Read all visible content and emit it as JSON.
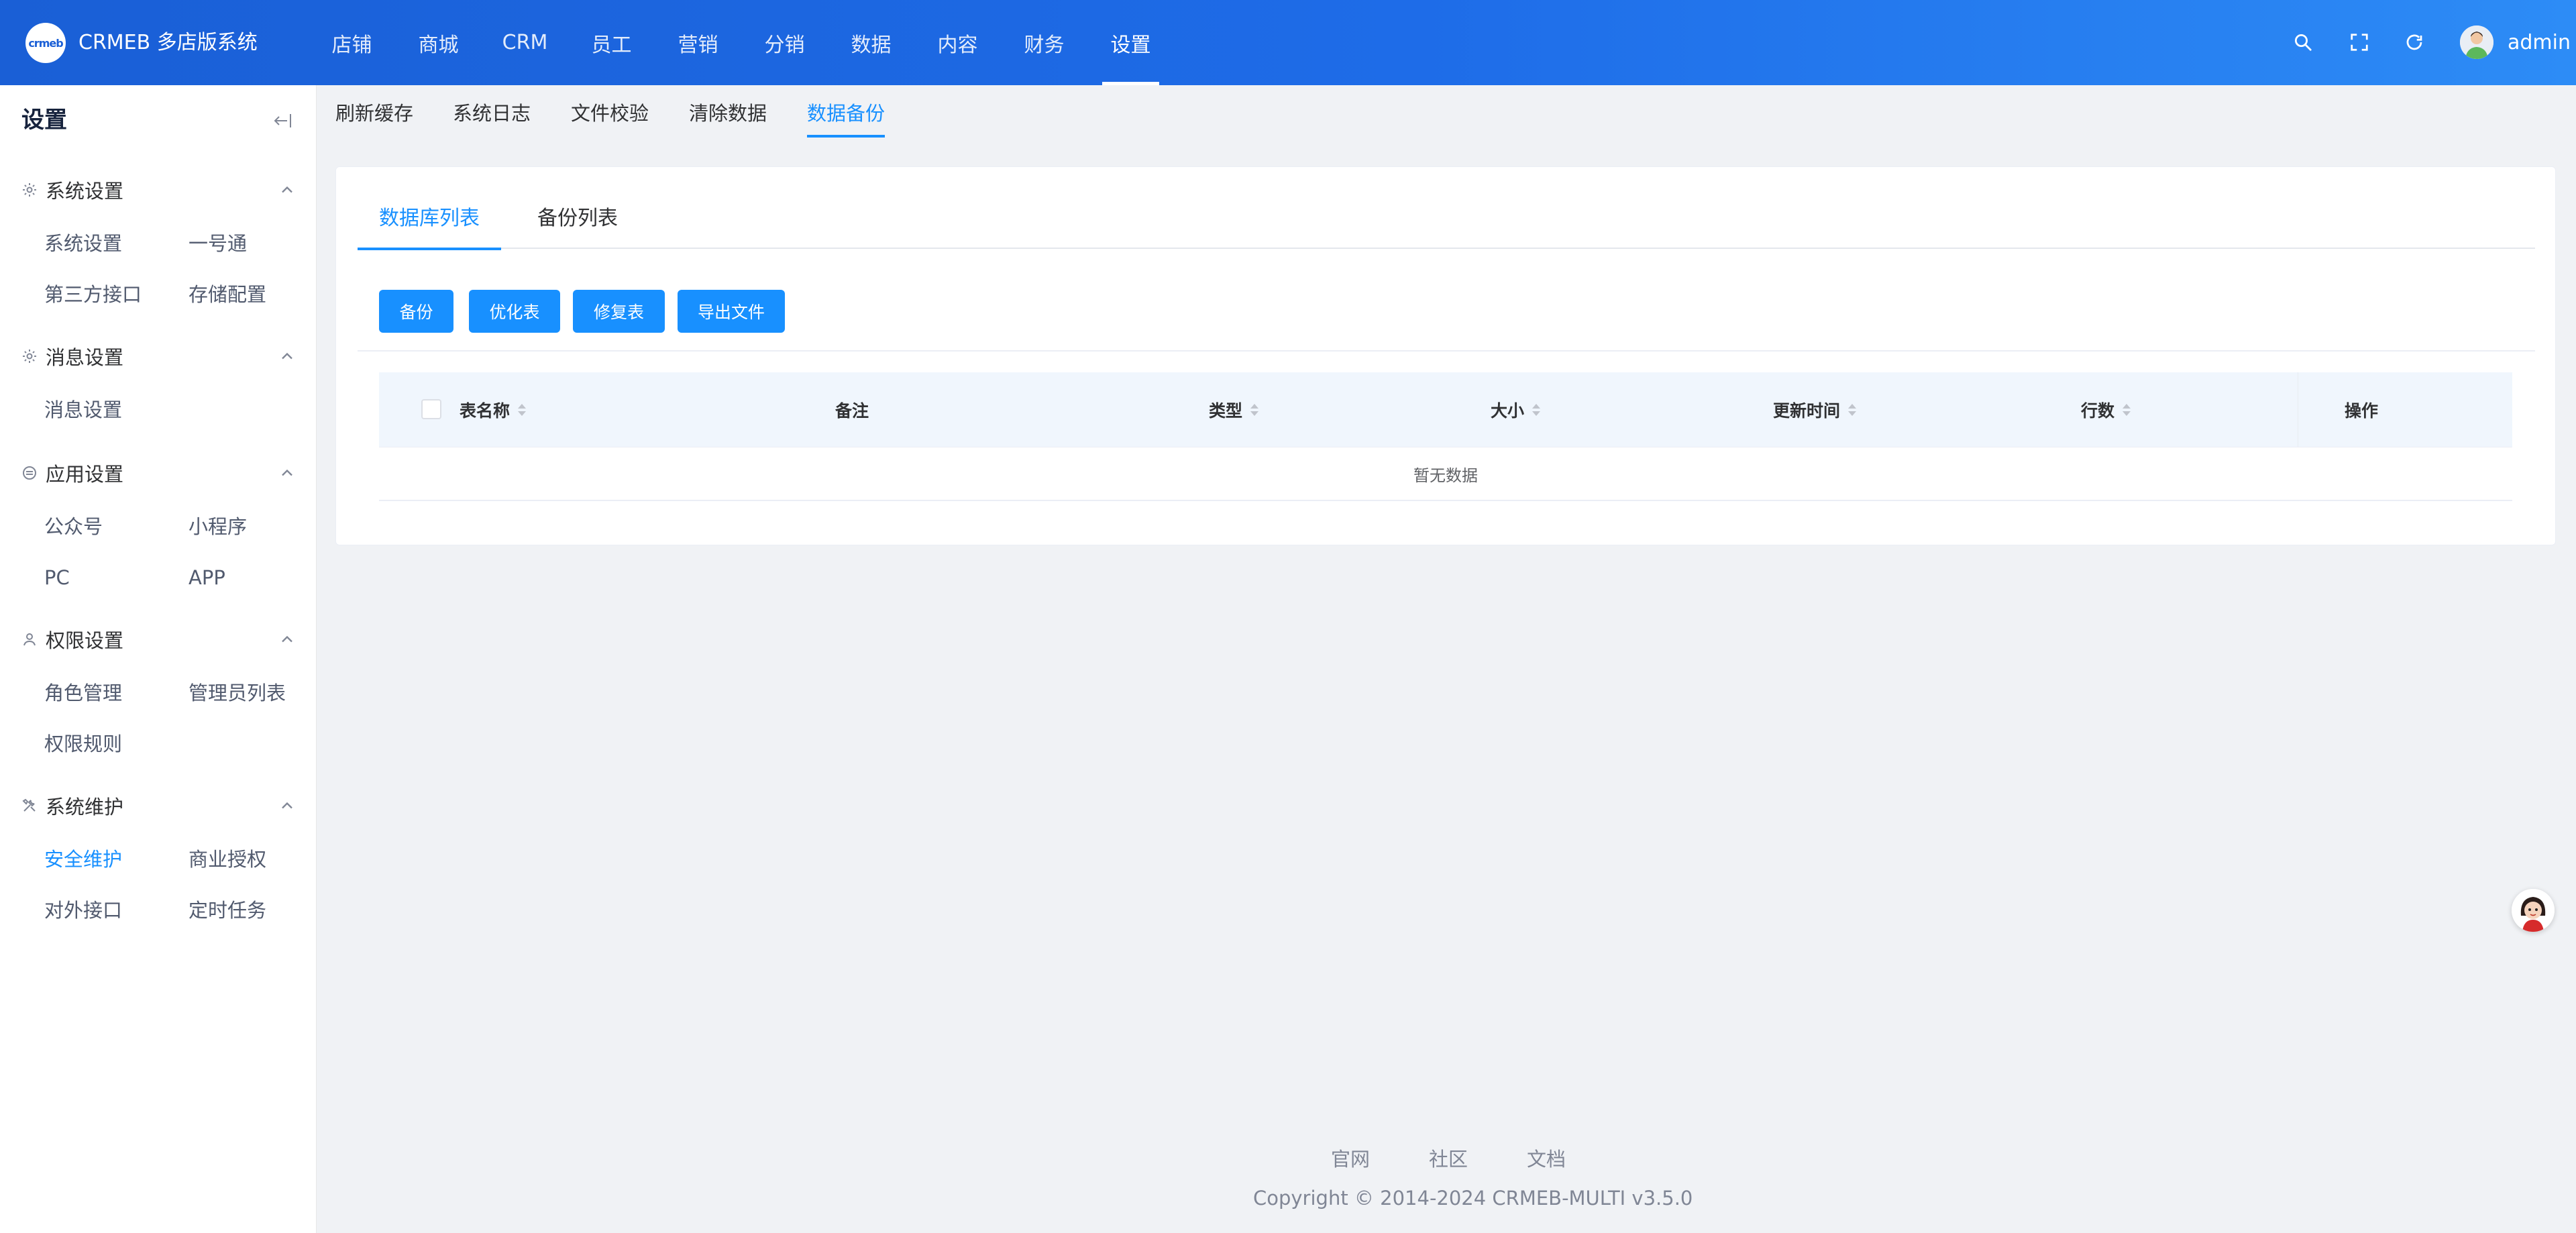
{
  "app": {
    "logo_text": "crmeb",
    "title": "CRMEB 多店版系统"
  },
  "header": {
    "nav": [
      {
        "label": "店铺",
        "active": false
      },
      {
        "label": "商城",
        "active": false
      },
      {
        "label": "CRM",
        "active": false
      },
      {
        "label": "员工",
        "active": false
      },
      {
        "label": "营销",
        "active": false
      },
      {
        "label": "分销",
        "active": false
      },
      {
        "label": "数据",
        "active": false
      },
      {
        "label": "内容",
        "active": false
      },
      {
        "label": "财务",
        "active": false
      },
      {
        "label": "设置",
        "active": true
      }
    ],
    "icons": [
      "search-icon",
      "fullscreen-icon",
      "refresh-icon"
    ],
    "user": "admin"
  },
  "sidebar": {
    "title": "设置",
    "groups": [
      {
        "label": "系统设置",
        "icon": "gear-icon",
        "items": [
          "系统设置",
          "一号通",
          "第三方接口",
          "存储配置"
        ]
      },
      {
        "label": "消息设置",
        "icon": "gear-icon",
        "items": [
          "消息设置"
        ]
      },
      {
        "label": "应用设置",
        "icon": "circle-icon",
        "items": [
          "公众号",
          "小程序",
          "PC",
          "APP"
        ]
      },
      {
        "label": "权限设置",
        "icon": "user-icon",
        "items": [
          "角色管理",
          "管理员列表",
          "权限规则"
        ]
      },
      {
        "label": "系统维护",
        "icon": "tools-icon",
        "items": [
          "安全维护",
          "商业授权",
          "对外接口",
          "定时任务"
        ]
      }
    ],
    "active_item": "安全维护"
  },
  "subtabs": [
    {
      "label": "刷新缓存",
      "active": false
    },
    {
      "label": "系统日志",
      "active": false
    },
    {
      "label": "文件校验",
      "active": false
    },
    {
      "label": "清除数据",
      "active": false
    },
    {
      "label": "数据备份",
      "active": true
    }
  ],
  "card": {
    "tabs": [
      {
        "label": "数据库列表",
        "active": true
      },
      {
        "label": "备份列表",
        "active": false
      }
    ],
    "buttons": [
      "备份",
      "优化表",
      "修复表",
      "导出文件"
    ],
    "table": {
      "columns": [
        {
          "label": "表名称",
          "sortable": true
        },
        {
          "label": "备注",
          "sortable": false
        },
        {
          "label": "类型",
          "sortable": true
        },
        {
          "label": "大小",
          "sortable": true
        },
        {
          "label": "更新时间",
          "sortable": true
        },
        {
          "label": "行数",
          "sortable": true
        },
        {
          "label": "操作",
          "sortable": false
        }
      ],
      "empty_text": "暂无数据"
    }
  },
  "footer": {
    "links": [
      "官网",
      "社区",
      "文档"
    ],
    "copyright": "Copyright © 2014-2024 CRMEB-MULTI v3.5.0"
  },
  "colors": {
    "primary": "#1890ff",
    "header_start": "#1a5fd6",
    "header_end": "#2d8cf6",
    "background": "#f0f2f5"
  }
}
